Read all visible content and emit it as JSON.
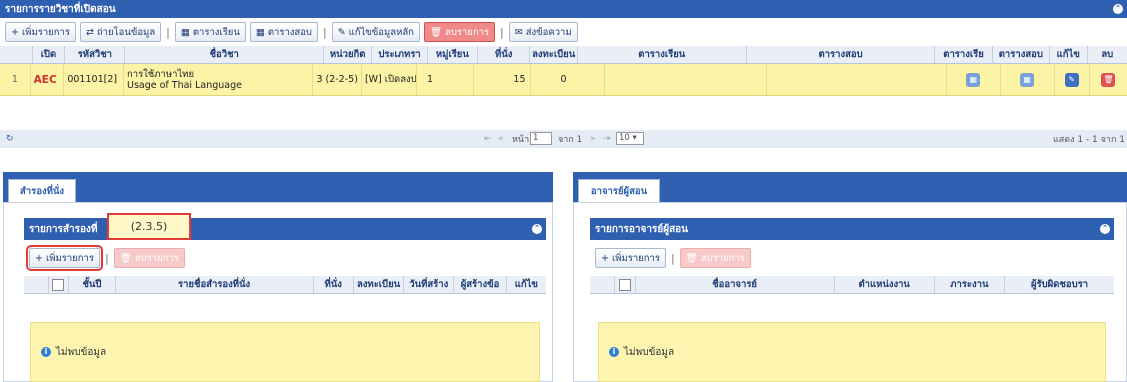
{
  "top_panel": {
    "title": "รายการรายวิชาที่เปิดสอน",
    "toolbar": {
      "add": "เพิ่มรายการ",
      "transfer": "ถ่ายโอนข้อมูล",
      "class_schedule": "ตารางเรียน",
      "exam_schedule": "ตารางสอบ",
      "edit_main": "แก้ไขข้อมูลหลัก",
      "delete": "ลบรายการ",
      "send_message": "ส่งข้อความ"
    },
    "columns": [
      "เปิด",
      "รหัสวิชา",
      "ชื่อวิชา",
      "หน่วยกิต",
      "ประเภทรา",
      "หมู่เรียน",
      "ที่นั่ง",
      "ลงทะเบียน",
      "ตารางเรียน",
      "ตารางสอบ",
      "ตารางเรีย",
      "ตารางสอบ",
      "แก้ไข",
      "ลบ"
    ],
    "rows": [
      {
        "no": "1",
        "badge": "AEC",
        "code": "001101[2]",
        "name_th": "การใช้ภาษาไทย",
        "name_en": "Usage of Thai Language",
        "credit": "3 (2-2-5)",
        "type": "[W] เปิดลงป",
        "section": "1",
        "seats": "15",
        "registered": "0"
      }
    ],
    "pager": {
      "page_label": "หน้า",
      "page_value": "1",
      "of_text": "จาก 1",
      "page_size": "10",
      "summary": "แสดง 1 - 1 จาก 1"
    }
  },
  "left_section": {
    "tab": "สำรองที่นั่ง",
    "panel_title": "รายการสำรองที่",
    "annotation": "(2.3.5)",
    "add": "เพิ่มรายการ",
    "delete": "ลบรายการ",
    "columns": [
      "ชั้นปี",
      "รายชื่อสำรองที่นั่ง",
      "ที่นั่ง",
      "ลงทะเบียน",
      "วันที่สร้าง",
      "ผู้สร้างข้อ",
      "แก้ไข"
    ],
    "empty": "ไม่พบข้อมูล"
  },
  "right_section": {
    "tab": "อาจารย์ผู้สอน",
    "panel_title": "รายการอาจารย์ผู้สอน",
    "add": "เพิ่มรายการ",
    "delete": "ลบรายการ",
    "columns": [
      "ชื่ออาจารย์",
      "ตำแหน่งงาน",
      "ภาระงาน",
      "ผู้รับผิดชอบรา"
    ],
    "empty": "ไม่พบข้อมูล"
  },
  "colors": {
    "header_blue": "#2f5fb0",
    "row_yellow": "#fbf3a6",
    "danger": "#f08a8a",
    "annotation_red": "#e53935"
  }
}
